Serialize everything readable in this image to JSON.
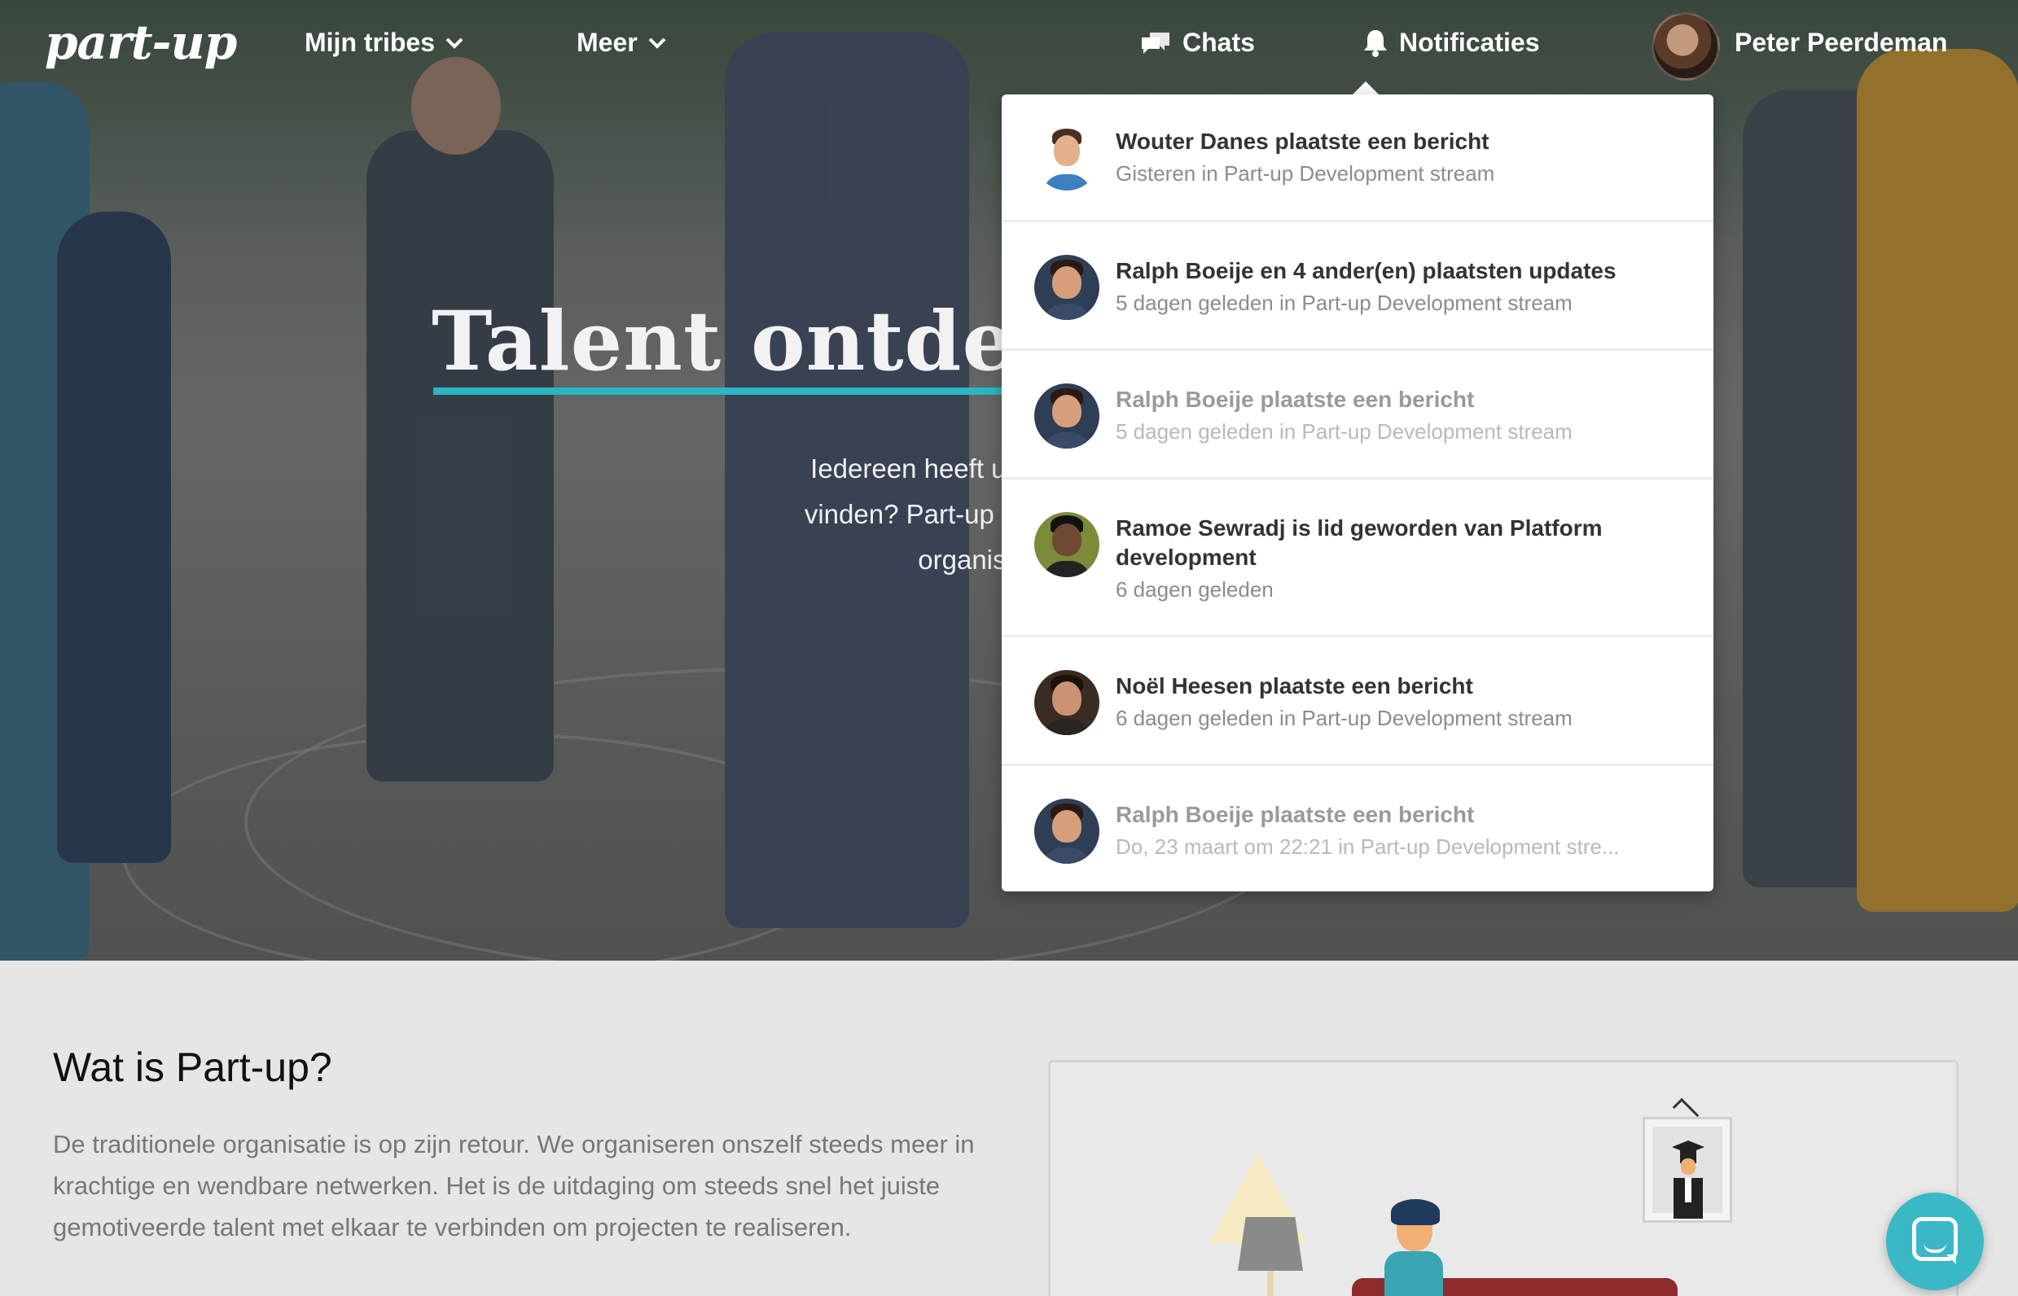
{
  "nav": {
    "logo": "part-up",
    "tribes_label": "Mijn tribes",
    "meer_label": "Meer",
    "chats_label": "Chats",
    "notifications_label": "Notificaties",
    "user_name": "Peter Peerdeman"
  },
  "hero": {
    "title": "Talent ontdekke",
    "subtitle_line1": "Iedereen heeft uniek talent. Hoe",
    "subtitle_line2": "vinden? Part-up verbindt talent in",
    "subtitle_line3": "organisaties e"
  },
  "notifications": [
    {
      "title": "Wouter Danes plaatste een bericht",
      "meta": "Gisteren in Part-up Development stream",
      "read": false
    },
    {
      "title": "Ralph Boeije en 4 ander(en) plaatsten updates",
      "meta": "5 dagen geleden in Part-up Development stream",
      "read": false
    },
    {
      "title": "Ralph Boeije plaatste een bericht",
      "meta": "5 dagen geleden in Part-up Development stream",
      "read": true
    },
    {
      "title": "Ramoe Sewradj is lid geworden van Platform development",
      "meta": "6 dagen geleden",
      "read": false
    },
    {
      "title": "Noël Heesen plaatste een bericht",
      "meta": "6 dagen geleden in Part-up Development stream",
      "read": false
    },
    {
      "title": "Ralph Boeije plaatste een bericht",
      "meta": "Do, 23 maart om 22:21 in Part-up Development stre...",
      "read": true
    }
  ],
  "about": {
    "title": "Wat is Part-up?",
    "text": "De traditionele organisatie is op zijn retour. We organiseren onszelf steeds meer in krachtige en wendbare netwerken. Het is de uitdaging om steeds snel het juiste gemotiveerde talent met elkaar te verbinden om projecten te realiseren."
  },
  "colors": {
    "accent": "#2bb6c3",
    "chat_button": "#3bb8c6"
  },
  "icons": {
    "chats": "chat-bubbles-icon",
    "notifications": "bell-icon",
    "dropdown": "chevron-down-icon",
    "support": "messenger-icon"
  }
}
